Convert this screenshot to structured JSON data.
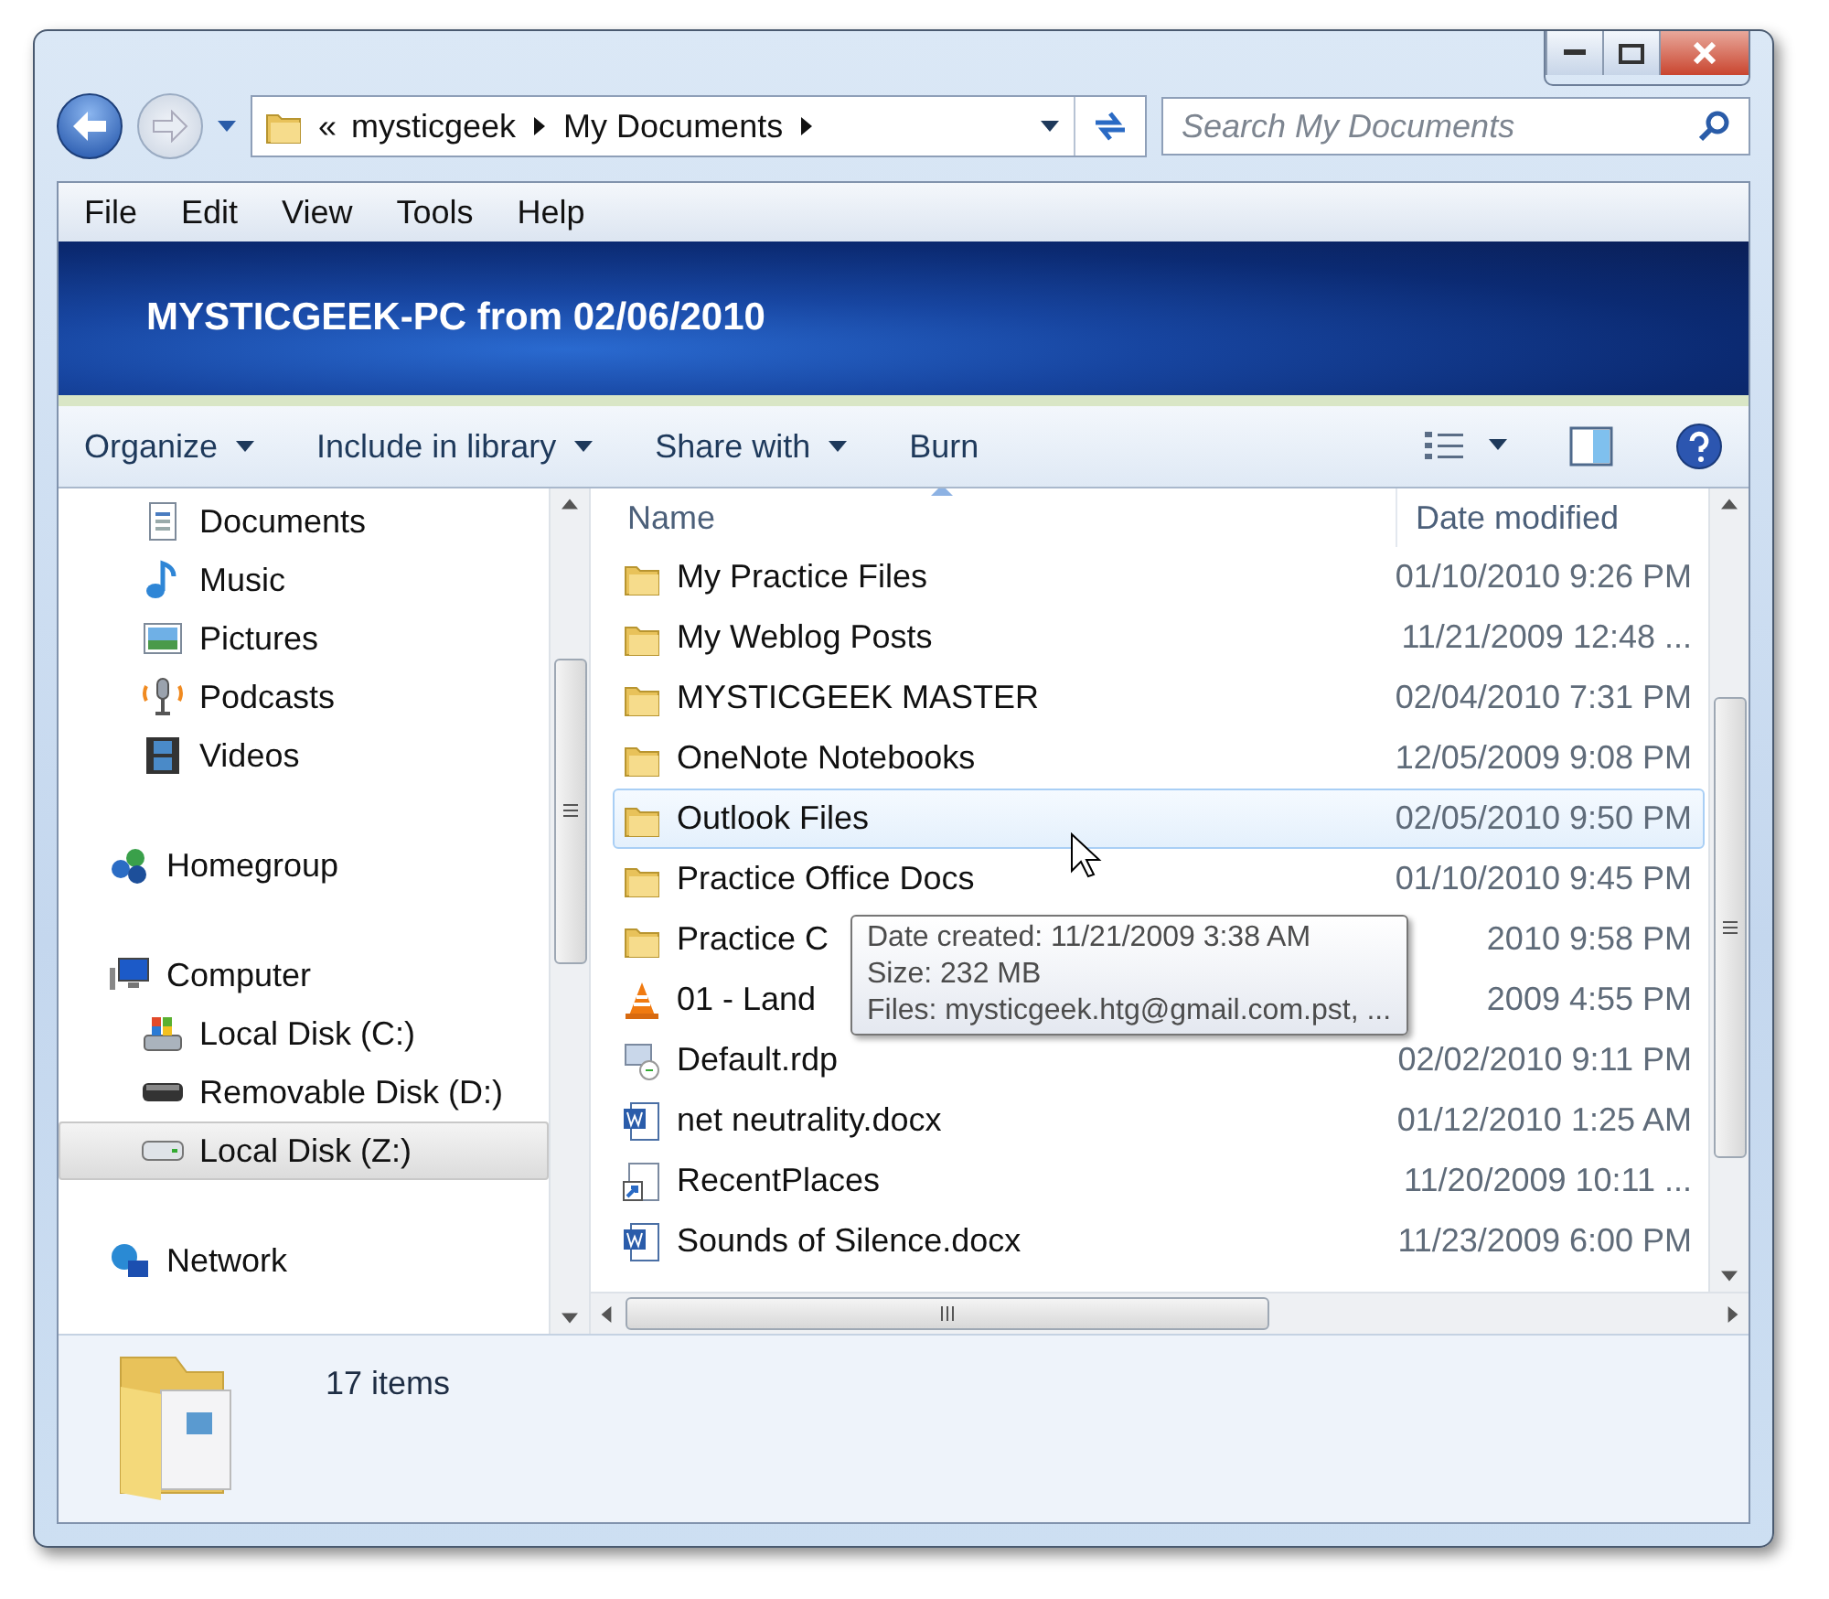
{
  "address": {
    "overflow": "«",
    "path": [
      {
        "label": "mysticgeek"
      },
      {
        "label": "My Documents"
      }
    ]
  },
  "search": {
    "placeholder": "Search My Documents"
  },
  "menu": [
    "File",
    "Edit",
    "View",
    "Tools",
    "Help"
  ],
  "banner": {
    "title": "MYSTICGEEK-PC from 02/06/2010"
  },
  "commands": [
    {
      "label": "Organize",
      "dropdown": true
    },
    {
      "label": "Include in library",
      "dropdown": true
    },
    {
      "label": "Share with",
      "dropdown": true
    },
    {
      "label": "Burn",
      "dropdown": false
    }
  ],
  "nav": [
    {
      "children": [
        {
          "label": "Documents",
          "kind": "documents",
          "selected": false
        },
        {
          "label": "Music",
          "kind": "music",
          "selected": false
        },
        {
          "label": "Pictures",
          "kind": "pictures",
          "selected": false
        },
        {
          "label": "Podcasts",
          "kind": "podcasts",
          "selected": false
        },
        {
          "label": "Videos",
          "kind": "videos",
          "selected": false
        }
      ]
    },
    {
      "label": "Homegroup",
      "kind": "homegroup",
      "selected": false
    },
    {
      "label": "Computer",
      "kind": "computer",
      "selected": false,
      "children": [
        {
          "label": "Local Disk (C:)",
          "kind": "systemdisk",
          "selected": false
        },
        {
          "label": "Removable Disk (D:)",
          "kind": "removable",
          "selected": false
        },
        {
          "label": "Local Disk (Z:)",
          "kind": "disk",
          "selected": true
        }
      ]
    },
    {
      "label": "Network",
      "kind": "network",
      "selected": false
    }
  ],
  "files": {
    "columns": [
      "Name",
      "Date modified"
    ],
    "rows": [
      {
        "name": "My Practice Files",
        "date": "01/10/2010 9:26 PM",
        "kind": "folder",
        "hovered": false
      },
      {
        "name": "My Weblog Posts",
        "date": "11/21/2009 12:48 ...",
        "kind": "folder",
        "hovered": false
      },
      {
        "name": "MYSTICGEEK MASTER",
        "date": "02/04/2010 7:31 PM",
        "kind": "folder",
        "hovered": false
      },
      {
        "name": "OneNote Notebooks",
        "date": "12/05/2009 9:08 PM",
        "kind": "folder",
        "hovered": false
      },
      {
        "name": "Outlook Files",
        "date": "02/05/2010 9:50 PM",
        "kind": "folder",
        "hovered": true
      },
      {
        "name": "Practice Office Docs",
        "date": "01/10/2010 9:45 PM",
        "kind": "folder",
        "hovered": false
      },
      {
        "name": "Practice C",
        "date": "2010 9:58 PM",
        "kind": "folder",
        "hovered": false
      },
      {
        "name": "01 - Land",
        "date": "2009 4:55 PM",
        "kind": "media",
        "hovered": false
      },
      {
        "name": "Default.rdp",
        "date": "02/02/2010 9:11 PM",
        "kind": "rdp",
        "hovered": false
      },
      {
        "name": "net neutrality.docx",
        "date": "01/12/2010 1:25 AM",
        "kind": "docx",
        "hovered": false
      },
      {
        "name": "RecentPlaces",
        "date": "11/20/2009 10:11 ...",
        "kind": "shortcut",
        "hovered": false
      },
      {
        "name": "Sounds of Silence.docx",
        "date": "11/23/2009 6:00 PM",
        "kind": "docx",
        "hovered": false
      }
    ]
  },
  "tooltip": [
    "Date created: 11/21/2009 3:38 AM",
    "Size: 232 MB",
    "Files: mysticgeek.htg@gmail.com.pst, ..."
  ],
  "details": {
    "count": "17 items"
  }
}
